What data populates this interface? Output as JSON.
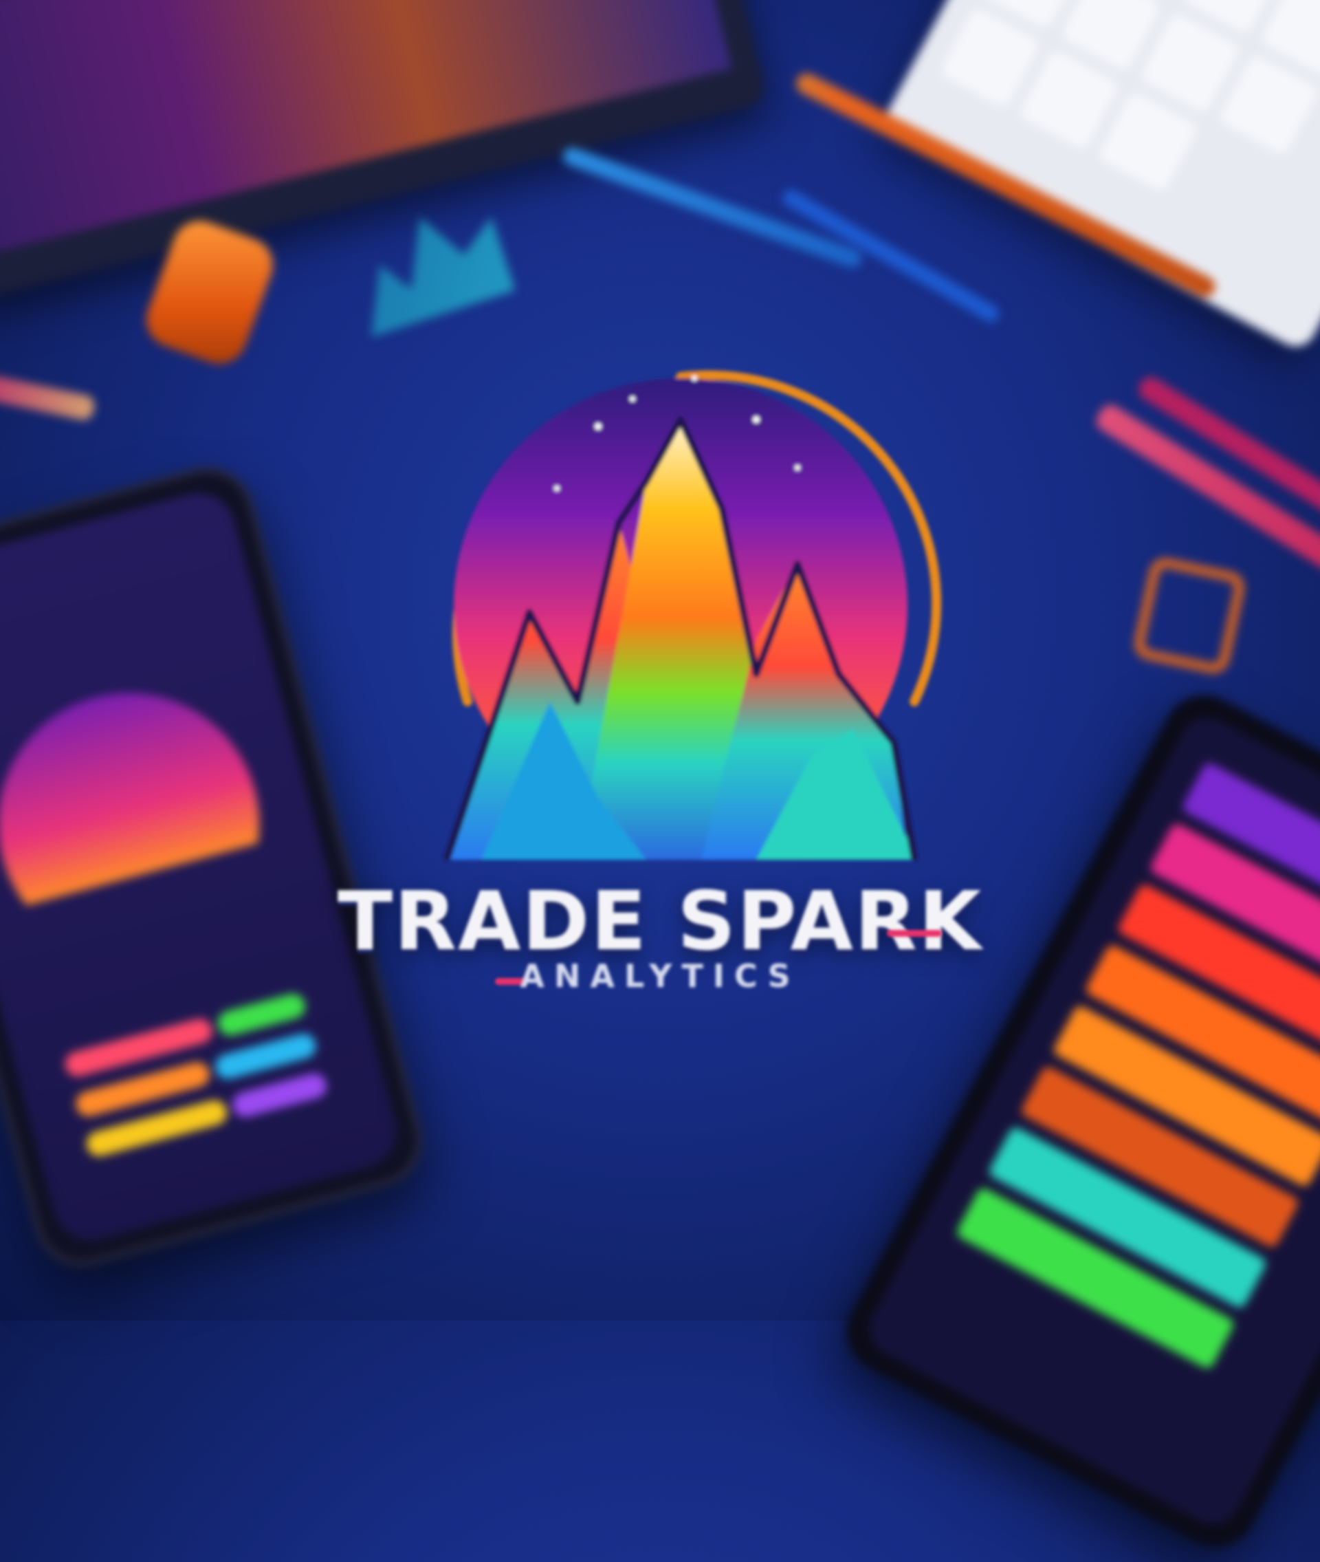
{
  "brand": {
    "title": "TRADE SPARK",
    "subtitle": "ANALYTICS"
  },
  "colors": {
    "background": "#172c85",
    "ring": "#e88a1e",
    "accent_pink": "#e8336a",
    "accent_orange": "#ff8a2a",
    "accent_cyan": "#2ad3e0",
    "accent_purple": "#7a1fb0"
  },
  "objects": [
    "monitor",
    "keyboard",
    "orange-pencil",
    "blue-pens",
    "pink-pencils",
    "pencil-sharpener",
    "binder-clip",
    "smartphone",
    "tablet"
  ]
}
